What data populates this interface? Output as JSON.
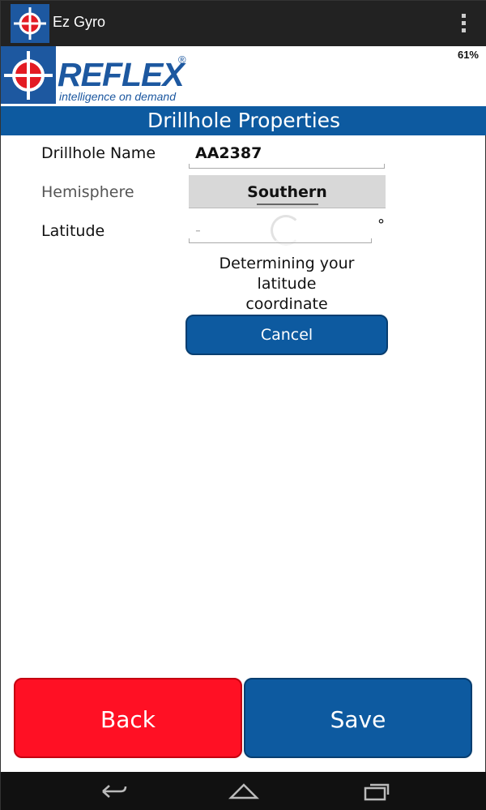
{
  "app": {
    "title": "Ez Gyro",
    "icon": "reflex-crosshair-icon",
    "overflow_icon": "overflow-menu-icon"
  },
  "status": {
    "battery": "61%"
  },
  "logo": {
    "wordmark": "REFLEX",
    "registered": "®",
    "tagline": "intelligence on demand",
    "brand_color": "#1d58a0"
  },
  "page": {
    "title": "Drillhole Properties"
  },
  "form": {
    "drillhole_name_label": "Drillhole Name",
    "drillhole_name_value": "AA2387",
    "hemisphere_label": "Hemisphere",
    "hemisphere_value": "Southern",
    "latitude_label": "Latitude",
    "latitude_value": "-",
    "latitude_unit": "°",
    "status_line_1": "Determining your",
    "status_line_2": "latitude",
    "status_line_3": "coordinate",
    "cancel_label": "Cancel"
  },
  "actions": {
    "back_label": "Back",
    "save_label": "Save",
    "back_color": "#ff1024",
    "save_color": "#0d5aa0"
  },
  "navbar": {
    "icons": [
      "back-nav-icon",
      "home-nav-icon",
      "recent-apps-icon"
    ]
  }
}
